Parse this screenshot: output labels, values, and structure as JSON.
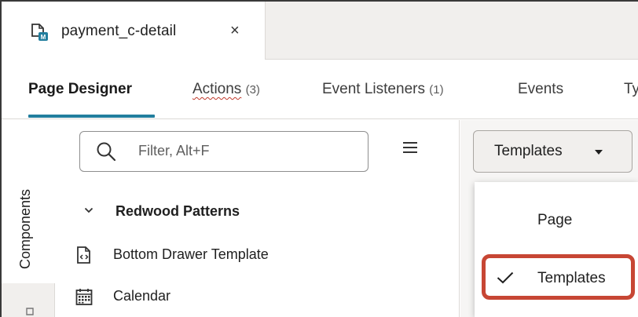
{
  "file_tab": {
    "name": "payment_c-detail",
    "close_glyph": "×",
    "icon": "page-module-icon"
  },
  "nav_tabs": [
    {
      "label": "Page Designer",
      "count": ""
    },
    {
      "label": "Actions",
      "count": "(3)"
    },
    {
      "label": "Event Listeners",
      "count": "(1)"
    },
    {
      "label": "Events",
      "count": ""
    },
    {
      "label": "Typ",
      "count": ""
    }
  ],
  "rail": {
    "active_label": "Components"
  },
  "components": {
    "search_placeholder": "Filter, Alt+F",
    "group": {
      "label": "Redwood Patterns",
      "expanded": true
    },
    "items": [
      {
        "label": "Bottom Drawer Template",
        "icon": "template-icon"
      },
      {
        "label": "Calendar",
        "icon": "calendar-icon"
      }
    ]
  },
  "templates_menu": {
    "button_label": "Templates",
    "options": [
      {
        "label": "Page",
        "checked": false
      },
      {
        "label": "Templates",
        "checked": true
      }
    ]
  },
  "colors": {
    "accent": "#227e9e",
    "highlight": "#c74634",
    "brand_badge": "#227e9e"
  }
}
